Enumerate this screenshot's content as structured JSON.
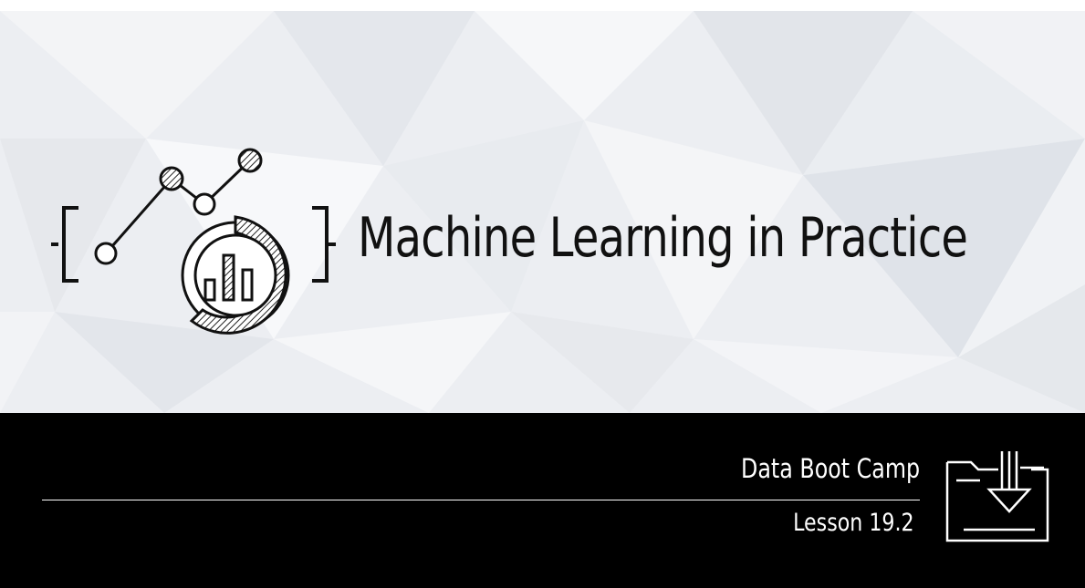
{
  "slide": {
    "title": "Machine Learning in Practice",
    "course": "Data Boot Camp",
    "lesson": "Lesson 19.2"
  },
  "icons": {
    "logo": "ml-analytics-logo-icon",
    "folder": "folder-download-icon"
  },
  "colors": {
    "top_background": "#eef0f3",
    "bottom_background": "#000000",
    "title_text": "#111111",
    "bottom_text": "#ffffff"
  }
}
